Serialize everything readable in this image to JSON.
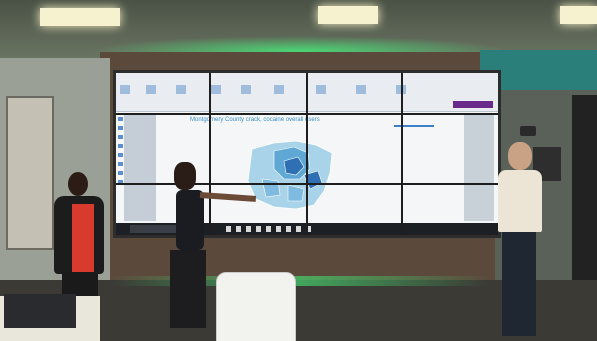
{
  "video_wall": {
    "document_title": "Montgomery County crack, cocaine overall users",
    "document_subtitle": "",
    "window_title": "",
    "taskbar_search": "",
    "colors": {
      "title_blue": "#3a8fc7",
      "map_light": "#a9d3e8",
      "map_mid": "#5fa8d6",
      "map_dark": "#2f6fb3",
      "accent_purple": "#6a2a8a"
    }
  },
  "scene": {
    "colors": {
      "ceiling_glow": "#46e678",
      "back_wall": "#5b4a3c",
      "floor": "#3b3a35"
    }
  }
}
